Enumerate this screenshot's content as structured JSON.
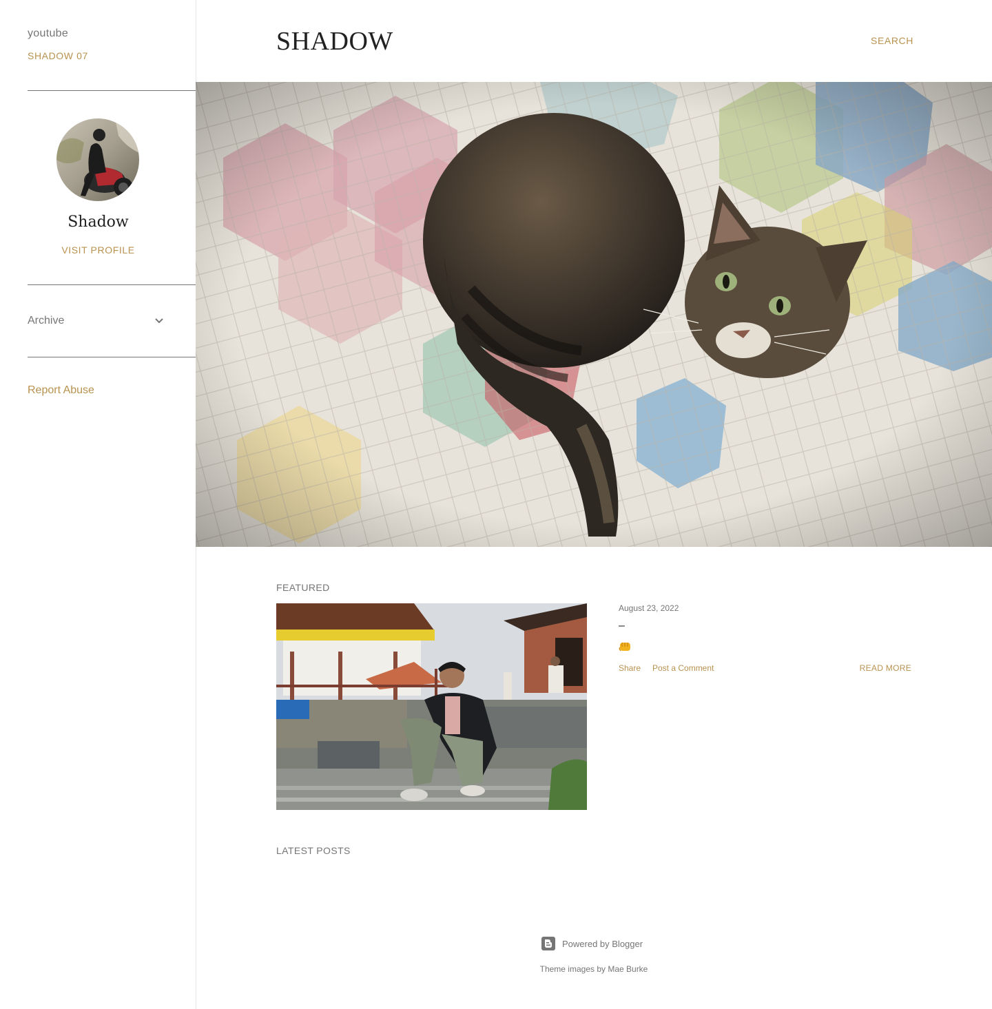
{
  "sidebar": {
    "links": [
      {
        "label": "youtube"
      },
      {
        "label": "SHADOW 07"
      }
    ],
    "profile": {
      "name": "Shadow",
      "visit_label": "VISIT PROFILE"
    },
    "archive": {
      "label": "Archive",
      "icon": "chevron-down-icon"
    },
    "report_abuse": "Report Abuse"
  },
  "header": {
    "title": "SHADOW",
    "search_label": "SEARCH"
  },
  "featured": {
    "section_title": "FEATURED",
    "post": {
      "date": "August 23, 2022",
      "title": "–",
      "snippet_icon": "fist-emoji-icon",
      "share_label": "Share",
      "comment_label": "Post a Comment",
      "read_more_label": "READ MORE"
    }
  },
  "latest": {
    "section_title": "LATEST POSTS"
  },
  "footer": {
    "powered_by": "Powered by Blogger",
    "theme_credit": "Theme images by Mae Burke"
  },
  "colors": {
    "accent": "#b8924f",
    "text_muted": "#757575",
    "text_dark": "#212121"
  }
}
